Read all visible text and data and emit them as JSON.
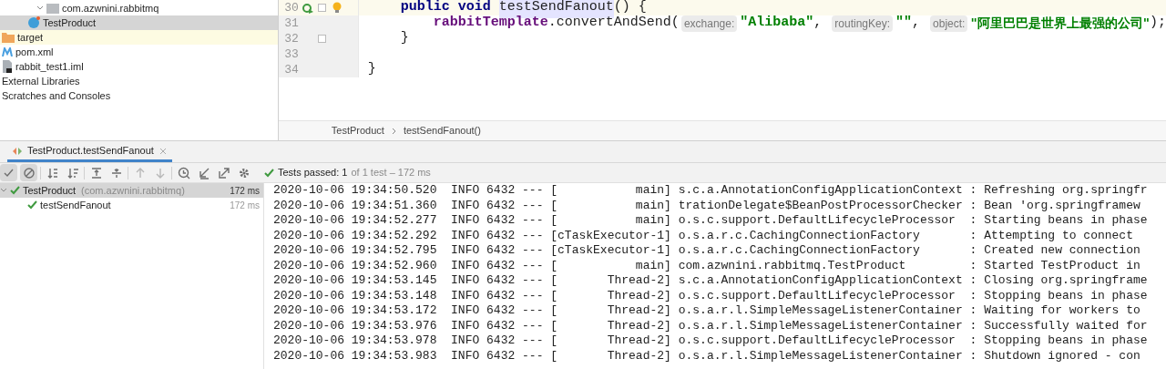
{
  "project_tree": [
    {
      "label": "com.azwnini.rabbitmq",
      "kind": "package",
      "expanded": true,
      "selected": false,
      "children": [
        {
          "label": "TestProduct",
          "kind": "class",
          "selected": true
        }
      ]
    },
    {
      "label": "target",
      "kind": "excluded-folder",
      "selected": false
    },
    {
      "label": "pom.xml",
      "kind": "maven",
      "selected": false
    },
    {
      "label": "rabbit_test1.iml",
      "kind": "module-file",
      "selected": false
    },
    {
      "label": "External Libraries",
      "kind": "plain",
      "selected": false
    },
    {
      "label": "Scratches and Consoles",
      "kind": "plain",
      "selected": false
    }
  ],
  "editor": {
    "lines": [
      {
        "number": "30",
        "current": true,
        "run_marker": true,
        "bulb": true,
        "fold": true,
        "tokens": [
          {
            "kind": "keyword",
            "text": "    public void "
          },
          {
            "kind": "decl",
            "text": "testSendFanout"
          },
          {
            "kind": "plain",
            "text": "() {"
          }
        ]
      },
      {
        "number": "31",
        "current": false,
        "run_marker": false,
        "bulb": false,
        "fold": false,
        "tokens": [
          {
            "kind": "field",
            "text": "        rabbitTemplate"
          },
          {
            "kind": "plain",
            "text": ".convertAndSend("
          },
          {
            "kind": "hint",
            "text": "exchange:"
          },
          {
            "kind": "string",
            "text": "\"Alibaba\""
          },
          {
            "kind": "plain",
            "text": ", "
          },
          {
            "kind": "hint",
            "text": "routingKey:"
          },
          {
            "kind": "string",
            "text": "\"\""
          },
          {
            "kind": "plain",
            "text": ", "
          },
          {
            "kind": "hint",
            "text": "object:"
          },
          {
            "kind": "string",
            "text": "\"阿里巴巴是世界上最强的公司\""
          },
          {
            "kind": "plain",
            "text": ");"
          }
        ]
      },
      {
        "number": "32",
        "current": false,
        "run_marker": false,
        "bulb": false,
        "fold": true,
        "tokens": [
          {
            "kind": "plain",
            "text": "    }"
          }
        ]
      },
      {
        "number": "33",
        "current": false,
        "run_marker": false,
        "bulb": false,
        "fold": false
      },
      {
        "number": "34",
        "current": false,
        "run_marker": false,
        "bulb": false,
        "fold": false,
        "tokens": [
          {
            "kind": "plain",
            "text": "}"
          }
        ]
      }
    ],
    "breadcrumbs": [
      "TestProduct",
      "testSendFanout()"
    ]
  },
  "run_tab": {
    "label": "TestProduct.testSendFanout",
    "selected": true
  },
  "toolbar": [
    {
      "kind": "check",
      "on": true
    },
    {
      "kind": "stop",
      "on": true
    },
    {
      "kind": "sort-alpha",
      "on": false
    },
    {
      "kind": "sort-duration",
      "on": false
    },
    {
      "kind": "expand",
      "on": false
    },
    {
      "kind": "collapse",
      "on": false
    },
    {
      "kind": "up",
      "on": false
    },
    {
      "kind": "down",
      "on": false
    },
    {
      "kind": "history",
      "on": false
    },
    {
      "kind": "import",
      "on": false
    },
    {
      "kind": "export",
      "on": false
    },
    {
      "kind": "settings",
      "on": false
    }
  ],
  "status": {
    "summary": "Tests passed: 1",
    "detail": "of 1 test – 172 ms"
  },
  "test_tree": [
    {
      "name": "TestProduct",
      "package": "(com.azwnini.rabbitmq)",
      "time": "172 ms",
      "selected": true,
      "children": [
        {
          "name": "testSendFanout",
          "time": "172 ms",
          "selected": false
        }
      ]
    }
  ],
  "console": [
    "2020-10-06 19:34:50.520  INFO 6432 --- [           main] s.c.a.AnnotationConfigApplicationContext : Refreshing org.springfr",
    "2020-10-06 19:34:51.360  INFO 6432 --- [           main] trationDelegate$BeanPostProcessorChecker : Bean 'org.springframew",
    "2020-10-06 19:34:52.277  INFO 6432 --- [           main] o.s.c.support.DefaultLifecycleProcessor  : Starting beans in phase",
    "2020-10-06 19:34:52.292  INFO 6432 --- [cTaskExecutor-1] o.s.a.r.c.CachingConnectionFactory       : Attempting to connect",
    "2020-10-06 19:34:52.795  INFO 6432 --- [cTaskExecutor-1] o.s.a.r.c.CachingConnectionFactory       : Created new connection",
    "2020-10-06 19:34:52.960  INFO 6432 --- [           main] com.azwnini.rabbitmq.TestProduct         : Started TestProduct in",
    "2020-10-06 19:34:53.145  INFO 6432 --- [       Thread-2] s.c.a.AnnotationConfigApplicationContext : Closing org.springframe",
    "2020-10-06 19:34:53.148  INFO 6432 --- [       Thread-2] o.s.c.support.DefaultLifecycleProcessor  : Stopping beans in phase",
    "2020-10-06 19:34:53.172  INFO 6432 --- [       Thread-2] o.s.a.r.l.SimpleMessageListenerContainer : Waiting for workers to",
    "2020-10-06 19:34:53.976  INFO 6432 --- [       Thread-2] o.s.a.r.l.SimpleMessageListenerContainer : Successfully waited for",
    "2020-10-06 19:34:53.978  INFO 6432 --- [       Thread-2] o.s.c.support.DefaultLifecycleProcessor  : Stopping beans in phase",
    "2020-10-06 19:34:53.983  INFO 6432 --- [       Thread-2] o.s.a.r.l.SimpleMessageListenerContainer : Shutdown ignored - con"
  ]
}
